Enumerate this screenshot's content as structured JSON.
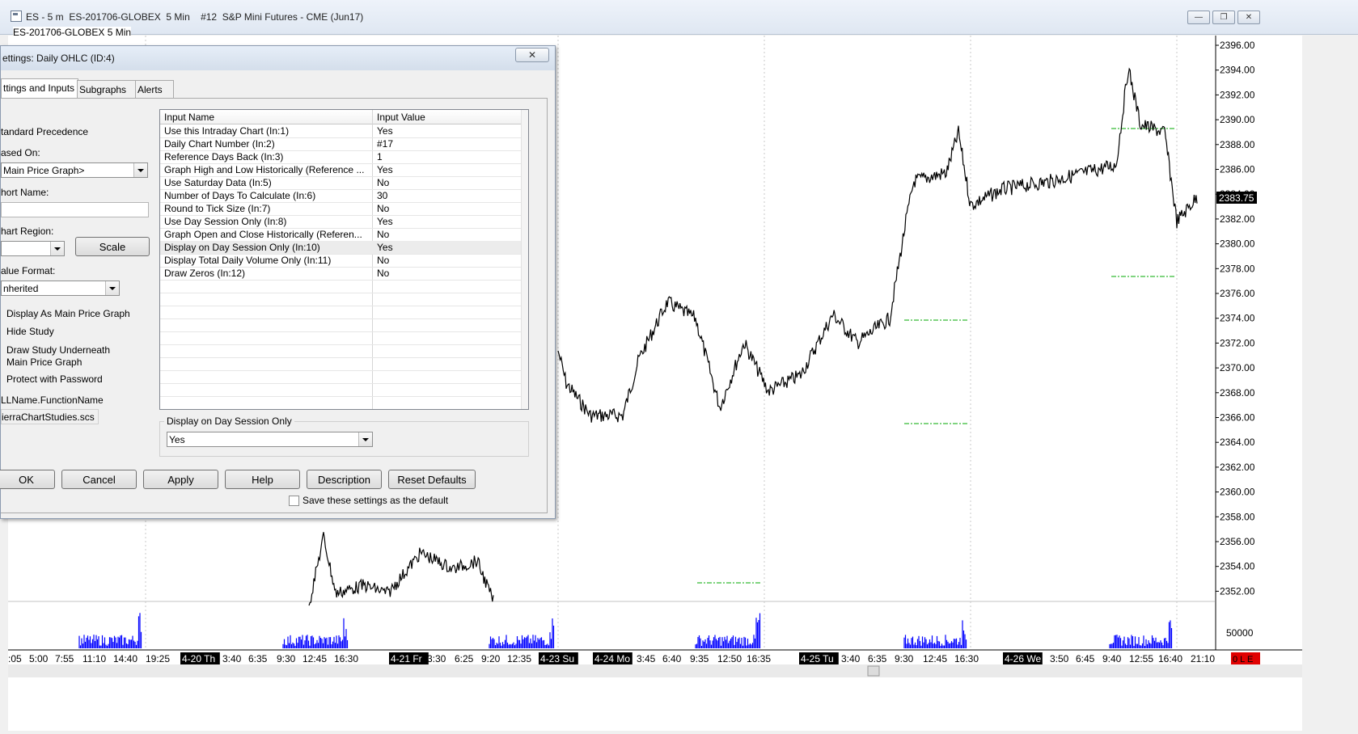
{
  "window": {
    "title": "ES - 5 m  ES-201706-GLOBEX  5 Min    #12  S&P Mini Futures - CME (Jun17)",
    "chart_label": "ES-201706-GLOBEX 5 Min",
    "min_label": "—",
    "restore_label": "❐",
    "close_label": "✕"
  },
  "chart": {
    "price_labels": [
      "2396.00",
      "2394.00",
      "2392.00",
      "2390.00",
      "2388.00",
      "2386.00",
      "2384.00",
      "2382.00",
      "2380.00",
      "2378.00",
      "2376.00",
      "2374.00",
      "2372.00",
      "2370.00",
      "2368.00",
      "2366.00",
      "2364.00",
      "2362.00",
      "2360.00",
      "2358.00",
      "2356.00",
      "2354.00",
      "2352.00"
    ],
    "last_price": "2383.75",
    "volume_label": "50000",
    "time_labels": [
      ":05",
      "5:00",
      "7:55",
      "11:10",
      "14:40",
      "19:25",
      "4-20 Th",
      "3:40",
      "6:35",
      "9:30",
      "12:45",
      "16:30",
      "4-21 Fr",
      "3:30",
      "6:25",
      "9:20",
      "12:35",
      "4-23 Su",
      "4-24 Mo",
      "3:45",
      "6:40",
      "9:35",
      "12:50",
      "16:35",
      "4-25 Tu",
      "3:40",
      "6:35",
      "9:30",
      "12:45",
      "16:30",
      "4-26 We",
      "3:50",
      "6:45",
      "9:40",
      "12:55",
      "16:40",
      "21:10"
    ],
    "corner_label": "0 L E",
    "colors": {
      "price": "#000000",
      "volume": "#0000ff",
      "ohlc": "#00aa00",
      "last": "#000000",
      "corner": "#e00000"
    }
  },
  "dialog": {
    "title": "ettings: Daily OHLC (ID:4)",
    "close_icon": "✕",
    "tabs": [
      "ttings and Inputs",
      "Subgraphs",
      "Alerts"
    ],
    "left": {
      "precedence": "tandard Precedence",
      "based_on_label": "ased On:",
      "based_on_value": "Main Price Graph>",
      "short_name_label": "hort Name:",
      "short_name_value": "",
      "chart_region_label": "hart Region:",
      "chart_region_value": "",
      "scale_button": "Scale",
      "value_format_label": "alue Format:",
      "value_format_value": "nherited",
      "check_display_main": "Display As Main Price Graph",
      "check_hide": "Hide Study",
      "check_draw_under_1": "Draw Study Underneath",
      "check_draw_under_2": "Main Price Graph",
      "check_protect": "Protect with Password",
      "dll_label": "LLName.FunctionName",
      "dll_value": "ierraChartStudies.scs"
    },
    "grid": {
      "col_name": "Input Name",
      "col_value": "Input Value",
      "rows": [
        {
          "name": "Use this Intraday Chart  (In:1)",
          "value": "Yes"
        },
        {
          "name": "Daily Chart Number  (In:2)",
          "value": "#17"
        },
        {
          "name": "Reference Days Back  (In:3)",
          "value": "1"
        },
        {
          "name": "Graph High and Low Historically (Reference ...",
          "value": "Yes"
        },
        {
          "name": "Use Saturday Data  (In:5)",
          "value": "No"
        },
        {
          "name": "Number of Days To Calculate  (In:6)",
          "value": "30"
        },
        {
          "name": "Round to Tick Size  (In:7)",
          "value": "No"
        },
        {
          "name": "Use Day Session Only  (In:8)",
          "value": "Yes"
        },
        {
          "name": "Graph Open and Close Historically (Referen...",
          "value": "No"
        },
        {
          "name": "Display on Day Session Only  (In:10)",
          "value": "Yes"
        },
        {
          "name": "Display Total Daily Volume Only  (In:11)",
          "value": "No"
        },
        {
          "name": "Draw Zeros  (In:12)",
          "value": "No"
        }
      ]
    },
    "editor": {
      "label": "Display on Day Session Only",
      "value": "Yes"
    },
    "buttons": {
      "ok": "OK",
      "cancel": "Cancel",
      "apply": "Apply",
      "help": "Help",
      "description": "Description",
      "reset": "Reset Defaults"
    },
    "save_default": "Save these settings as the default"
  }
}
